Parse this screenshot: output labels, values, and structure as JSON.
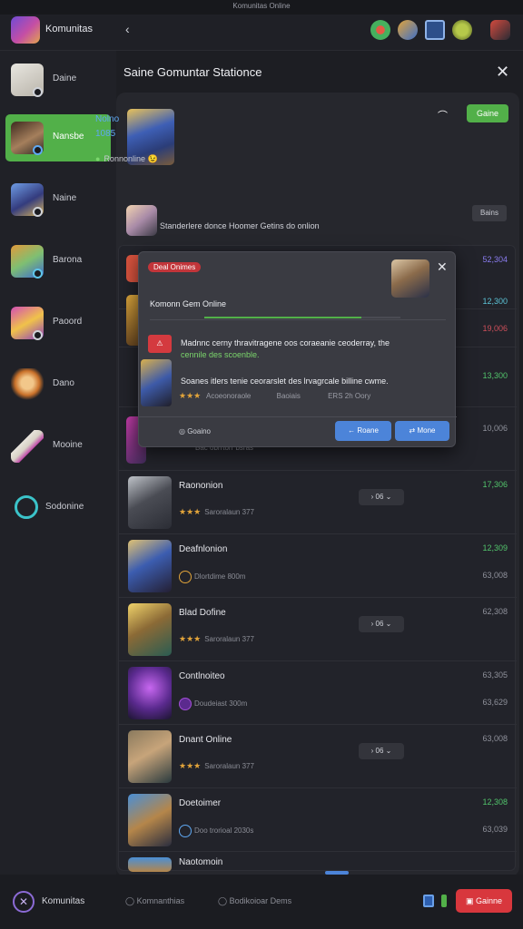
{
  "window": {
    "title": "Komunitas Online"
  },
  "app": {
    "name": "Komunitas"
  },
  "sidebar": {
    "items": [
      {
        "label": "Daine"
      },
      {
        "label": "Nansbe"
      },
      {
        "label": "Naine"
      },
      {
        "label": "Barona"
      },
      {
        "label": "Paoord"
      },
      {
        "label": "Dano"
      },
      {
        "label": "Mooine"
      },
      {
        "label": "Sodonine"
      }
    ],
    "bottom_label": "Komunitas"
  },
  "panel": {
    "title": "Saine Gomuntar Stationce",
    "hero": {
      "name": "Nolno",
      "sub": "1085",
      "status_icon": "green-dot",
      "status_text": "Ronnonline",
      "emoji": "😉"
    },
    "hero_button": "Gaine",
    "description": "Standerlere donce Hoomer Getins do onlion",
    "description_button": "Bains"
  },
  "rows": [
    {
      "name": "",
      "score": "52,304",
      "score_color": "#8a7cf0",
      "score2": ""
    },
    {
      "name": "",
      "score": "12,300",
      "score_color": "#5cc3d6",
      "score2": "19,006",
      "score2_color": "#cc4f5a"
    },
    {
      "name": "",
      "score": "13,300",
      "score_color": "#52c46b",
      "score2": ""
    },
    {
      "name": "",
      "sub": "Bac obrrtorr bsras",
      "score": "10,006",
      "score_color": "#8f919b",
      "score2": ""
    },
    {
      "name": "Raononion",
      "stars": "★★★",
      "sub": "Saroralaun 377",
      "pill": "06",
      "score": "17,306",
      "score_color": "#52c46b"
    },
    {
      "name": "Deafnlonion",
      "sub": "Dlortdime 800m",
      "score": "12,309",
      "score_color": "#52c46b",
      "score2": "63,008"
    },
    {
      "name": "Blad Dofine",
      "stars": "★★★",
      "sub": "Saroralaun 377",
      "pill": "06",
      "score": "62,308",
      "score_color": "#8f919b"
    },
    {
      "name": "Contlnoiteo",
      "sub": "Doudeiast 300m",
      "score": "63,305",
      "score_color": "#8f919b",
      "score2": "63,629"
    },
    {
      "name": "Dnant Online",
      "stars": "★★★",
      "sub": "Saroralaun 377",
      "pill": "06",
      "score": "63,008",
      "score_color": "#8f919b"
    },
    {
      "name": "Doetoimer",
      "sub": "Doo trorioal 2030s",
      "score": "12,308",
      "score_color": "#52c46b",
      "score2": "63,039"
    },
    {
      "name": "Naotomoin",
      "score": "",
      "score_color": "#8f919b"
    }
  ],
  "modal": {
    "tag": "Deal Onimes",
    "title": "Komonn Gem Online",
    "progress": 0.8,
    "warn_label": "⚠",
    "text1": "Madnnc cerny thravitragene oos coraeanie ceoderray, the",
    "text1b": "cennile des scoenble.",
    "text2": "Soanes itlers tenie ceorarslet des lrvagrcale billine cwme.",
    "meta_stars": "★★★",
    "meta1": "Acoeonoraole",
    "meta2": "Baoiais",
    "meta3": "ERS 2h Oory",
    "footer_label": "Goaino",
    "btn1": "Roane",
    "btn2": "Mone"
  },
  "footer": {
    "link1": "Komnanthias",
    "link2": "Bodikoioar Dems",
    "button": "Gainne"
  }
}
